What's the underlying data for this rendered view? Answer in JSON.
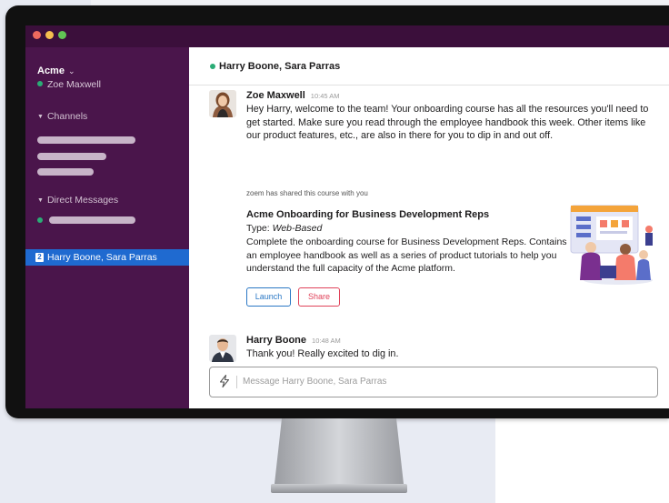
{
  "workspace": {
    "name": "Acme",
    "user": "Zoe Maxwell"
  },
  "sidebar": {
    "channels_label": "Channels",
    "dm_label": "Direct Messages",
    "selected_dm": {
      "count": "2",
      "label": "Harry Boone, Sara Parras"
    }
  },
  "conversation": {
    "title": "Harry Boone, Sara Parras"
  },
  "messages": [
    {
      "author": "Zoe Maxwell",
      "time": "10:45 AM",
      "text": "Hey Harry, welcome to the team! Your onboarding course has all the resources you'll need to get started. Make sure you read through the employee handbook this week. Other items like our product features, etc., are also in there for you to dip in and out off."
    },
    {
      "author": "Harry Boone",
      "time": "10:48 AM",
      "text": "Thank you! Really excited to dig in."
    }
  ],
  "share": {
    "notice": "zoem has shared this course with you",
    "title": "Acme Onboarding for Business Development Reps",
    "type_label": "Type:",
    "type_value": "Web-Based",
    "description": "Complete the onboarding course for Business Development Reps. Contains an employee handbook as well as a series of product tutorials to help you understand the full capacity of the Acme platform.",
    "launch_label": "Launch",
    "share_label": "Share"
  },
  "composer": {
    "placeholder": "Message Harry Boone, Sara Parras"
  },
  "colors": {
    "sidebar": "#4a154b",
    "titlebar": "#3b0f3b",
    "selected": "#1f6ad0",
    "online": "#2bac76",
    "launch": "#2b78c5",
    "share": "#e0435a"
  },
  "icons": [
    "close-dot-icon",
    "minimize-dot-icon",
    "maximize-dot-icon",
    "chevron-down-icon",
    "online-status-icon",
    "caret-down-icon",
    "lightning-bolt-icon"
  ]
}
